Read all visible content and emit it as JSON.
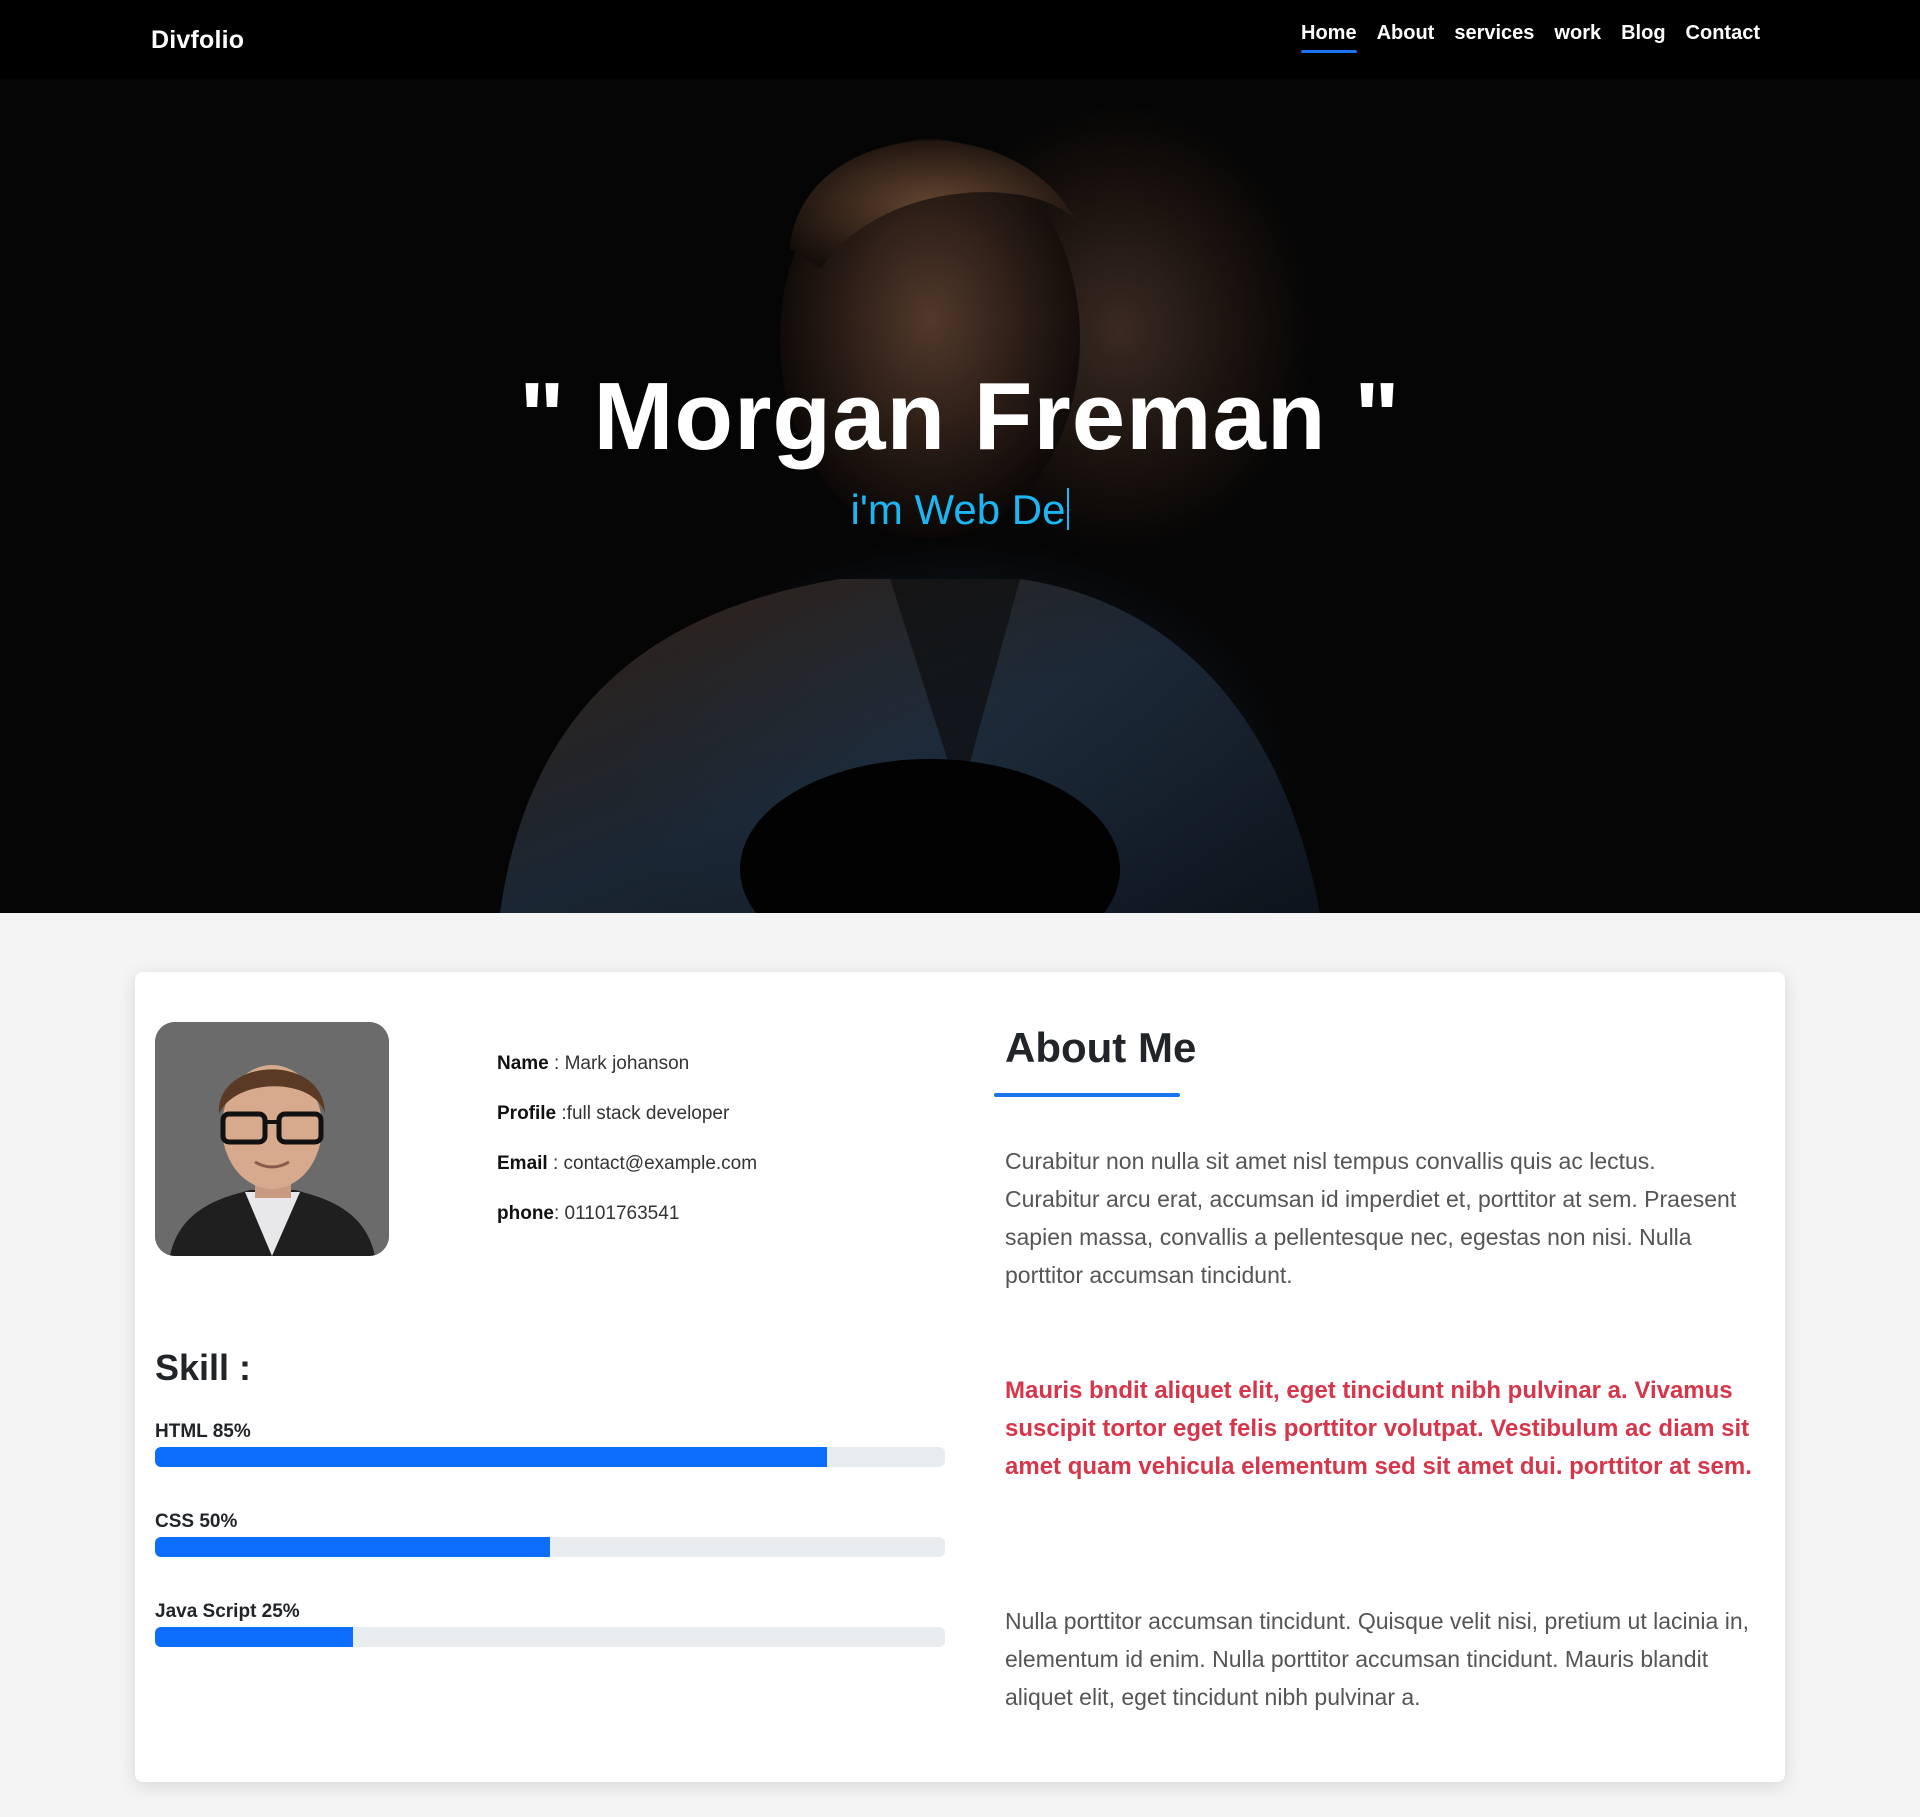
{
  "nav": {
    "brand": "Divfolio",
    "links": [
      {
        "label": "Home"
      },
      {
        "label": "About"
      },
      {
        "label": "services"
      },
      {
        "label": "work"
      },
      {
        "label": "Blog"
      },
      {
        "label": "Contact"
      }
    ],
    "active_color": "#1a73f0"
  },
  "hero": {
    "title": "\" Morgan Freman \"",
    "subtitle": "i'm Web De",
    "subtitle_color": "#1bb6f3"
  },
  "profile": {
    "name_label": "Name",
    "name_value": " : Mark johanson",
    "profile_label": "Profile",
    "profile_value": " :full stack developer",
    "email_label": "Email",
    "email_value": " : contact@example.com",
    "phone_label": "phone",
    "phone_value": ": 01101763541"
  },
  "skills": {
    "title": "Skill :",
    "items": [
      {
        "label": "HTML 85%",
        "percent": 85
      },
      {
        "label": "CSS 50%",
        "percent": 50
      },
      {
        "label": "Java Script 25%",
        "percent": 25
      }
    ],
    "bar_color": "#0d6efd"
  },
  "about": {
    "title": "About Me",
    "para1": "Curabitur non nulla sit amet nisl tempus convallis quis ac lectus. Curabitur arcu erat, accumsan id imperdiet et, porttitor at sem. Praesent sapien massa, convallis a pellentesque nec, egestas non nisi. Nulla porttitor accumsan tincidunt.",
    "para2": "Mauris bndit aliquet elit, eget tincidunt nibh pulvinar a. Vivamus suscipit tortor eget felis porttitor volutpat. Vestibulum ac diam sit amet quam vehicula elementum sed sit amet dui. porttitor at sem.",
    "para3": "Nulla porttitor accumsan tincidunt. Quisque velit nisi, pretium ut lacinia in, elementum id enim. Nulla porttitor accumsan tincidunt. Mauris blandit aliquet elit, eget tincidunt nibh pulvinar a.",
    "highlight_color": "#d6354a"
  }
}
